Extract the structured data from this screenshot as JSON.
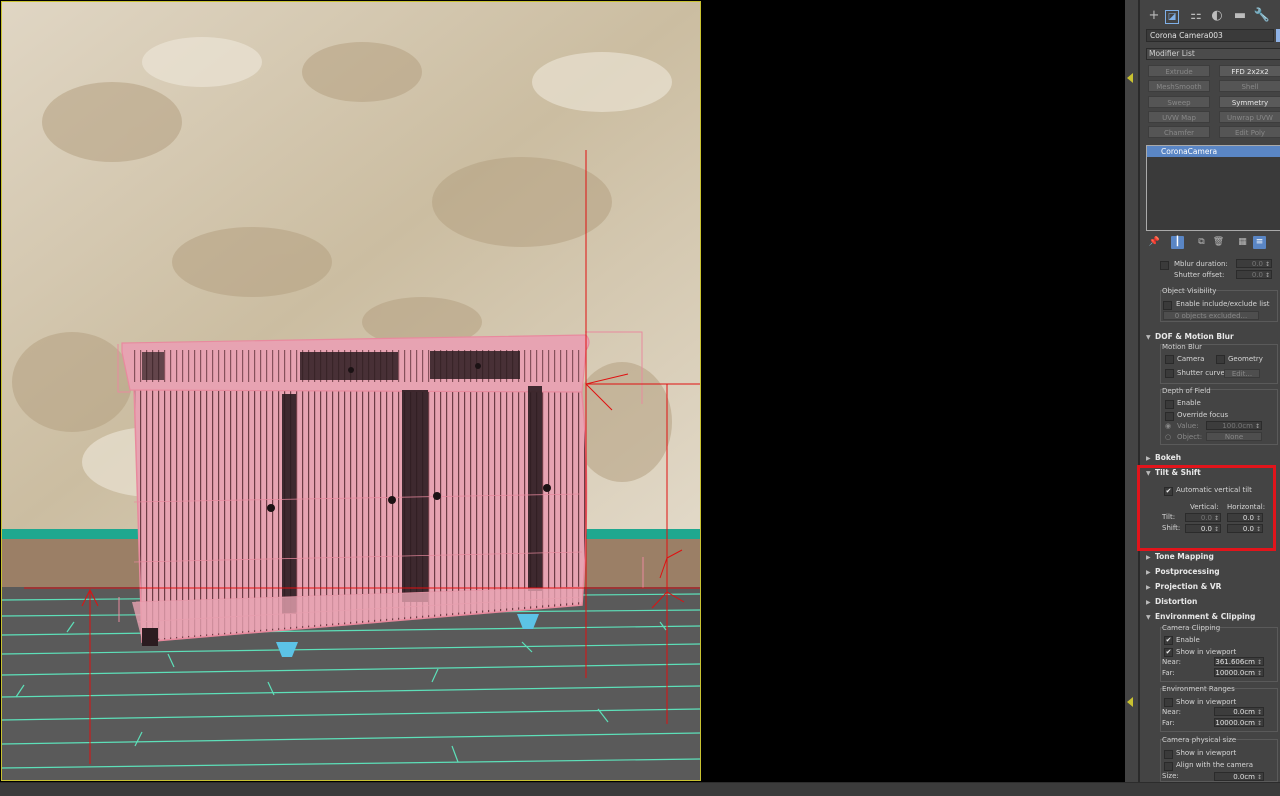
{
  "camera_name": "Corona Camera003",
  "modifier_list_label": "Modifier List",
  "modifier_buttons": [
    "Extrude",
    "FFD 2x2x2",
    "MeshSmooth",
    "Shell",
    "Sweep",
    "Symmetry",
    "UVW Map",
    "Unwrap UVW",
    "Chamfer",
    "Edit Poly"
  ],
  "modifier_stack": [
    "CoronaCamera"
  ],
  "motion_blur_top": {
    "mblur_duration_label": "Mblur duration:",
    "mblur_duration_value": "0.0",
    "shutter_offset_label": "Shutter offset:",
    "shutter_offset_value": "0.0"
  },
  "object_visibility": {
    "title": "Object Visibility",
    "enable_label": "Enable include/exclude list",
    "objects_excluded": "0 objects excluded..."
  },
  "dof_rollout": {
    "title": "DOF & Motion Blur",
    "motion_blur_title": "Motion Blur",
    "camera_label": "Camera",
    "geometry_label": "Geometry",
    "shutter_curve_label": "Shutter curve:",
    "edit_button": "Edit...",
    "dof_title": "Depth of Field",
    "enable_label": "Enable",
    "override_focus_label": "Override focus",
    "value_label": "Value:",
    "value": "100.0cm",
    "object_label": "Object:",
    "object_value": "None"
  },
  "bokeh_title": "Bokeh",
  "tilt_shift": {
    "title": "Tilt & Shift",
    "auto_vertical_label": "Automatic vertical tilt",
    "vertical_header": "Vertical:",
    "horizontal_header": "Horizontal:",
    "tilt_label": "Tilt:",
    "shift_label": "Shift:",
    "tilt_vertical": "0.0",
    "tilt_horizontal": "0.0",
    "shift_vertical": "0.0",
    "shift_horizontal": "0.0"
  },
  "collapsed_rollouts": [
    "Tone Mapping",
    "Postprocessing",
    "Projection & VR",
    "Distortion"
  ],
  "environment": {
    "title": "Environment & Clipping",
    "clipping_title": "Camera Clipping",
    "enable_label": "Enable",
    "show_viewport_label": "Show in viewport",
    "near_label": "Near:",
    "near_value": "361.606cm",
    "far_label": "Far:",
    "far_value": "10000.0cm",
    "ranges_title": "Environment Ranges",
    "ranges_show_label": "Show in viewport",
    "ranges_near_value": "0.0cm",
    "ranges_far_value": "10000.0cm",
    "physical_title": "Camera physical size",
    "physical_show_label": "Show in viewport",
    "align_label": "Align with the camera",
    "size_label": "Size:",
    "size_value": "0.0cm"
  },
  "colors": {
    "highlight": "#e2141b",
    "selection": "#5a86c5",
    "wireframe": "#e88a9e",
    "guide_red": "#e01010",
    "floor_lines": "#5de0b9",
    "viewport_frame": "#c9c231"
  }
}
